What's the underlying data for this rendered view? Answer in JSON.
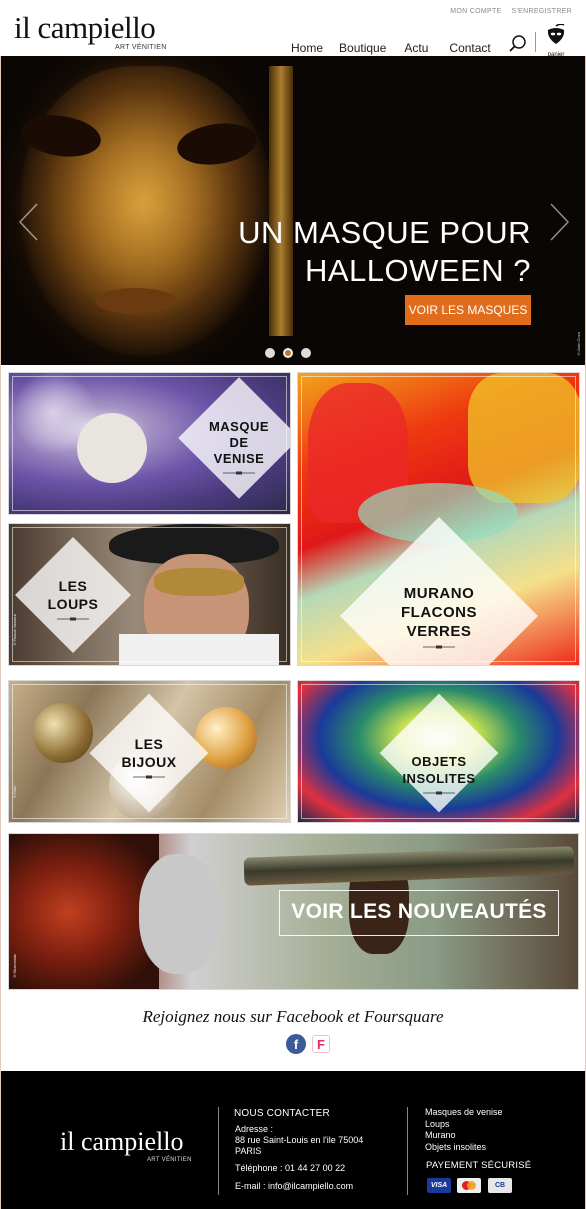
{
  "header": {
    "logo": "il campiello",
    "logo_sub": "ART VÉNITIEN",
    "top_links": [
      "MON COMPTE",
      "S'ENREGISTRER"
    ],
    "nav": [
      "Home",
      "Boutique",
      "Actu",
      "Contact"
    ],
    "cart_label": "panier"
  },
  "hero": {
    "title_line1": "UN MASQUE POUR",
    "title_line2": "HALLOWEEN ?",
    "button": "VOIR LES MASQUES",
    "slide_count": 3,
    "active_slide": 2,
    "credit": "©Alain Goza",
    "button_color": "#e06c1c"
  },
  "tiles": {
    "masque": {
      "line1": "MASQUE",
      "line2": "DE",
      "line3": "VENISE",
      "credit": "©Amazing"
    },
    "loups": {
      "line1": "LES",
      "line2": "LOUPS",
      "credit": "©Pascal Vasseur"
    },
    "murano": {
      "line1": "MURANO",
      "line2": "FLACONS",
      "line3": "VERRES"
    },
    "bijoux": {
      "line1": "LES",
      "line2": "BIJOUX",
      "credit": "©Olim"
    },
    "insolites": {
      "line1": "OBJETS",
      "line2": "INSOLITES"
    },
    "nouveautes": {
      "label": "VOIR LES NOUVEAUTÉS",
      "credit": "©Sbarcowitz"
    }
  },
  "social": {
    "text": "Rejoignez nous sur Facebook et Foursquare",
    "icons": [
      "facebook-icon",
      "foursquare-icon"
    ]
  },
  "footer": {
    "logo": "il campiello",
    "logo_sub": "ART VÉNITIEN",
    "contact_title": "NOUS CONTACTER",
    "address_label": "Adresse :",
    "address_line1": "88 rue Saint-Louis en l'ile 75004",
    "address_line2": "PARIS",
    "phone": "Téléphone : 01 44 27 00 22",
    "email": "E-mail : info@ilcampiello.com",
    "links": [
      "Masques de venise",
      "Loups",
      "Murano",
      "Objets insolites"
    ],
    "payment_title": "PAYEMENT SÉCURISÉ",
    "cards": [
      "VISA",
      "MasterCard",
      "CB"
    ]
  }
}
